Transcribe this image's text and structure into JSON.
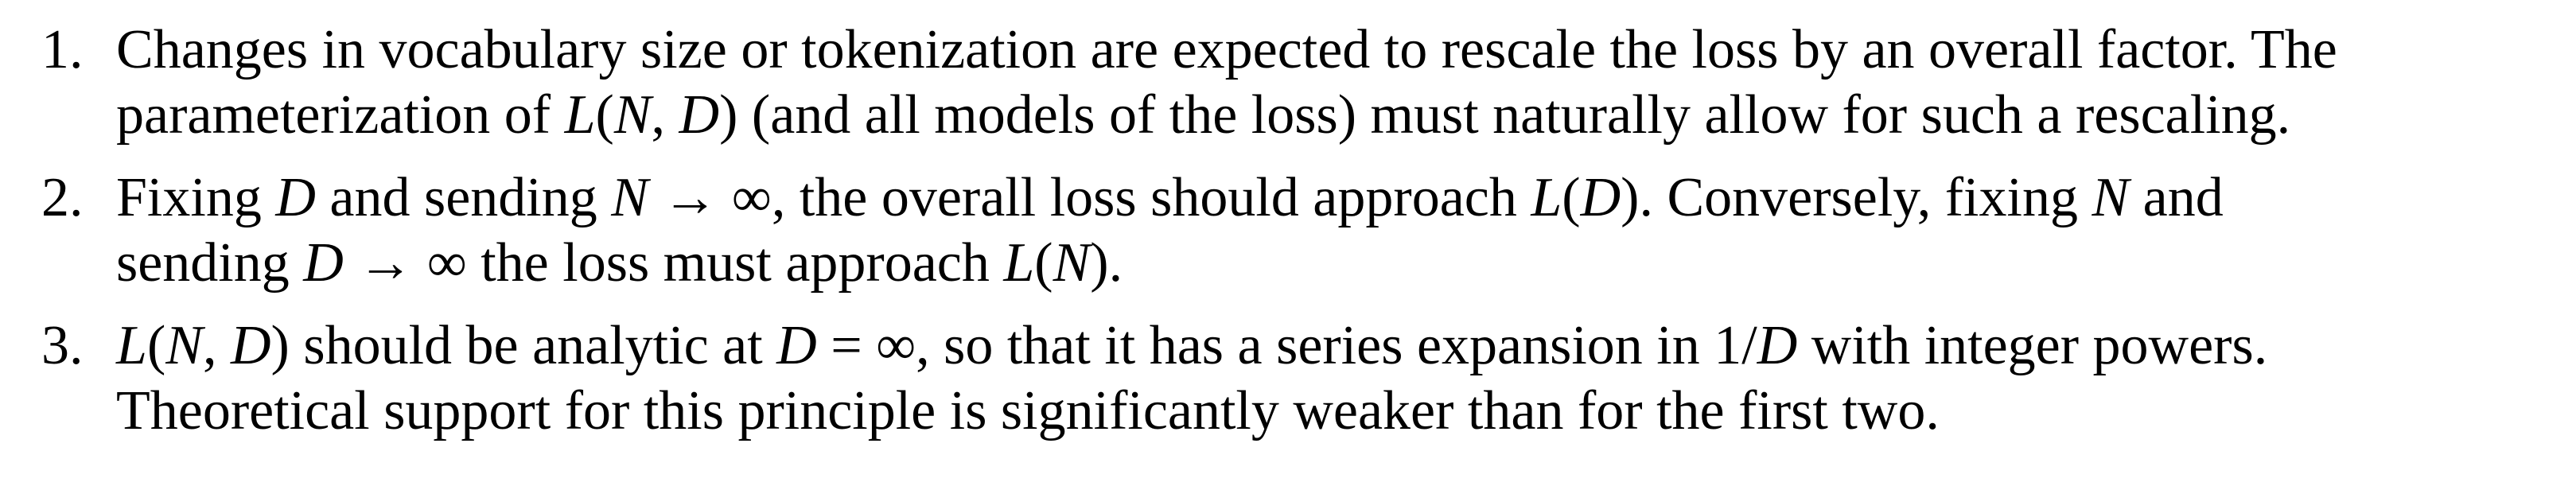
{
  "list": {
    "items": [
      {
        "number": "1.",
        "lines": [
          "Changes in vocabulary size or tokenization are expected to rescale the loss by an overall factor. The",
          "parameterization of L(N, D) (and all models of the loss) must naturally allow for such a rescaling."
        ]
      },
      {
        "number": "2.",
        "lines": [
          "Fixing D and sending N → ∞, the overall loss should approach L(D). Conversely, fixing N and",
          "sending D → ∞ the loss must approach L(N)."
        ]
      },
      {
        "number": "3.",
        "lines": [
          "L(N, D) should be analytic at D = ∞, so that it has a series expansion in 1/D with integer powers.",
          "Theoretical support for this principle is significantly weaker than for the first two."
        ]
      }
    ]
  }
}
